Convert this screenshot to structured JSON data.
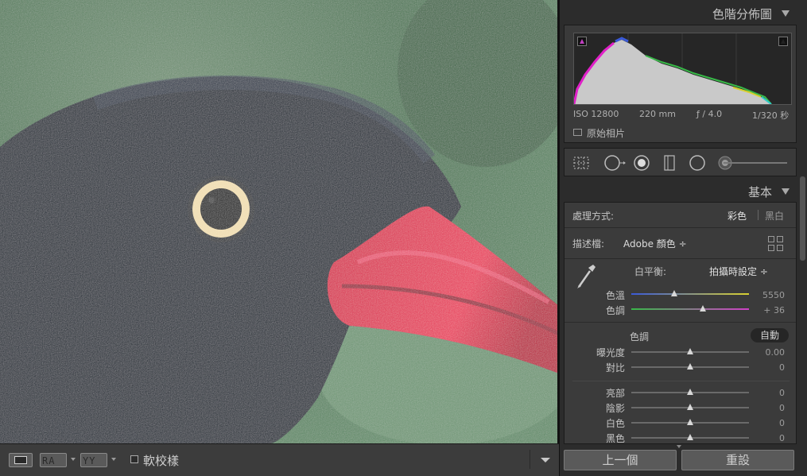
{
  "histogram": {
    "title": "色階分佈圖",
    "iso": "ISO 12800",
    "focal_length": "220 mm",
    "aperture": "ƒ / 4.0",
    "shutter": "1/320 秒",
    "original_photo_label": "原始相片",
    "clip_shadow_color": "#c040c0",
    "clip_highlight_color": "#222222"
  },
  "tools": [
    "crop-overlay-icon",
    "spot-removal-icon",
    "red-eye-icon",
    "graduated-filter-icon",
    "radial-filter-icon",
    "adjustment-brush-icon"
  ],
  "basic": {
    "title": "基本",
    "treatment_label": "處理方式:",
    "treatment_color": "彩色",
    "treatment_bw": "黑白",
    "profile_label": "描述檔:",
    "profile_value": "Adobe 顏色 ÷",
    "wb_label": "白平衡:",
    "wb_value": "拍攝時設定 ÷",
    "temp_label": "色溫",
    "temp_value": "5550",
    "tint_label": "色調",
    "tint_value": "+ 36",
    "tone_label": "色調",
    "auto_label": "自動",
    "exposure_label": "曝光度",
    "exposure_value": "0.00",
    "contrast_label": "對比",
    "contrast_value": "0",
    "highlights_label": "亮部",
    "highlights_value": "0",
    "shadows_label": "陰影",
    "shadows_value": "0",
    "whites_label": "白色",
    "whites_value": "0",
    "blacks_label": "黑色",
    "blacks_value": "0"
  },
  "toolbar": {
    "ra_label": "RA",
    "yy_label": "YY",
    "soft_proof_label": "軟校樣"
  },
  "buttons": {
    "previous_label": "上一個",
    "reset_label": "重設"
  },
  "colors": {
    "panel_bg": "#2c2c2c",
    "section_bg": "#3b3b3b",
    "beak": "#d8304e",
    "eye_ring": "#f0ddb0"
  }
}
